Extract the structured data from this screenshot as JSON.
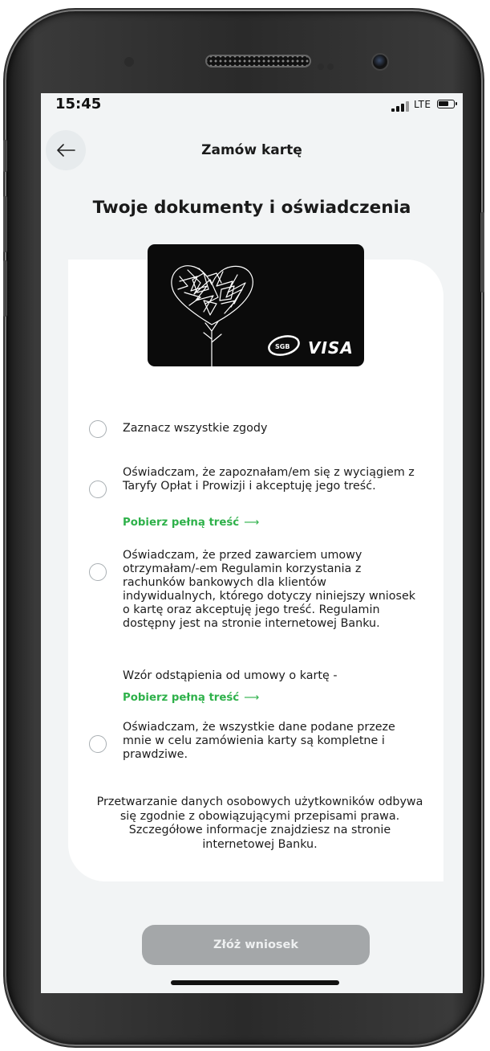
{
  "status_bar": {
    "time": "15:45",
    "network": "LTE"
  },
  "header": {
    "back_icon": "arrow-left-icon",
    "title": "Zamów kartę"
  },
  "page_title": "Twoje dokumenty i oświadczenia",
  "card": {
    "brand": "VISA",
    "logo_text": "SGB",
    "image": "heart-tree-illustration"
  },
  "consents": [
    {
      "label": "Zaznacz wszystkie zgody",
      "checked": false
    },
    {
      "label": "Oświadczam, że zapoznałam/em się z wyciągiem z Taryfy Opłat i Prowizji i akceptuję jego treść.",
      "checked": false,
      "link": "Pobierz pełną treść"
    },
    {
      "label": "Oświadczam, że przed zawarciem umowy otrzymałam/-em Regulamin korzystania z rachunków bankowych dla klientów indywidualnych, którego dotyczy niniejszy wniosek o kartę oraz akceptuję jego treść. Regulamin dostępny jest na stronie internetowej Banku.",
      "checked": false,
      "extra_text": "Wzór odstąpienia od umowy o kartę -",
      "link": "Pobierz pełną treść"
    },
    {
      "label": "Oświadczam, że wszystkie dane podane przeze mnie w celu zamówienia karty są kompletne i prawdziwe.",
      "checked": false
    }
  ],
  "info_text": "Przetwarzanie danych osobowych użytkowników odbywa się zgodnie z obowiązującymi przepisami prawa. Szczegółowe informacje znajdziesz na stronie internetowej Banku.",
  "submit_label": "Złóż wniosek",
  "colors": {
    "link_green": "#2eb14a",
    "disabled_button": "#a4a7a9",
    "background": "#f2f4f5"
  }
}
